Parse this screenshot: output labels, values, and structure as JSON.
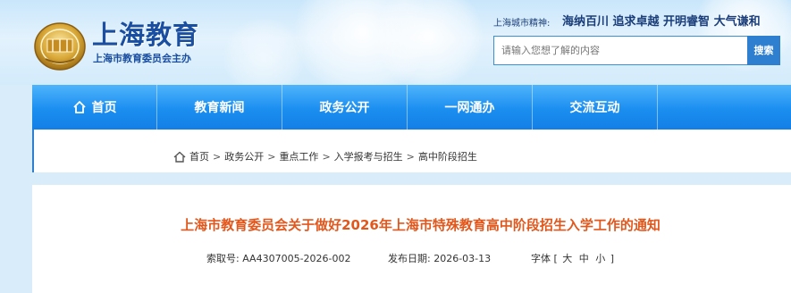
{
  "header": {
    "site_name": "上海教育",
    "site_sub": "上海市教育委员会主办",
    "motto_label": "上海城市精神:",
    "motto_text": "海纳百川 追求卓越 开明睿智 大气谦和"
  },
  "search": {
    "placeholder": "请输入您想了解的内容",
    "button_label": "搜索"
  },
  "nav": {
    "items": [
      {
        "label": "首页",
        "icon": "home-icon"
      },
      {
        "label": "教育新闻"
      },
      {
        "label": "政务公开"
      },
      {
        "label": "一网通办"
      },
      {
        "label": "交流互动"
      }
    ]
  },
  "breadcrumb": {
    "icon": "home-icon",
    "items": [
      "首页",
      "政务公开",
      "重点工作",
      "入学报考与招生",
      "高中阶段招生"
    ],
    "separator": ">"
  },
  "article": {
    "title": "上海市教育委员会关于做好2026年上海市特殊教育高中阶段招生入学工作的通知",
    "index_label": "索取号:",
    "index_value": "AA4307005-2026-002",
    "date_label": "发布日期:",
    "date_value": "2026-03-13",
    "font_label": "字体",
    "font_open": "[",
    "font_large": "大",
    "font_medium": "中",
    "font_small": "小",
    "font_close": "]"
  },
  "colors": {
    "nav_blue": "#1b8ef0",
    "title_orange": "#e2571c",
    "brand_blue": "#1a4ea0"
  }
}
